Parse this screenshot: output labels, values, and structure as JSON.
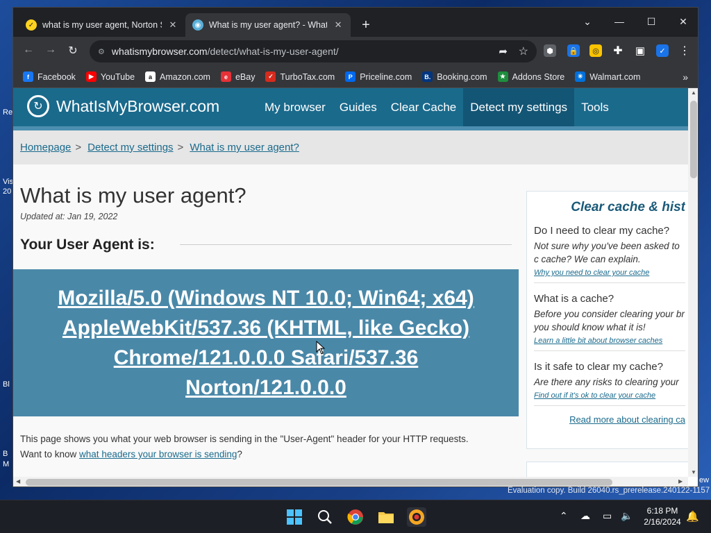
{
  "browser": {
    "tabs": [
      {
        "title": "what is my user agent, Norton S",
        "icon": "norton-icon"
      },
      {
        "title": "What is my user agent? - WhatIs",
        "icon": "whatismybrowser-icon"
      }
    ],
    "url_host": "whatismybrowser.com",
    "url_path": "/detect/what-is-my-user-agent/",
    "bookmarks": [
      {
        "label": "Facebook",
        "icon": "facebook-icon",
        "color": "#1877f2",
        "glyph": "f"
      },
      {
        "label": "YouTube",
        "icon": "youtube-icon",
        "color": "#ff0000",
        "glyph": "▶"
      },
      {
        "label": "Amazon.com",
        "icon": "amazon-icon",
        "color": "#ffffff",
        "glyph": "a"
      },
      {
        "label": "eBay",
        "icon": "ebay-icon",
        "color": "#e53238",
        "glyph": "e"
      },
      {
        "label": "TurboTax.com",
        "icon": "turbotax-icon",
        "color": "#d52b1e",
        "glyph": "✓"
      },
      {
        "label": "Priceline.com",
        "icon": "priceline-icon",
        "color": "#0068ef",
        "glyph": "P"
      },
      {
        "label": "Booking.com",
        "icon": "booking-icon",
        "color": "#003580",
        "glyph": "B."
      },
      {
        "label": "Addons Store",
        "icon": "addons-store-icon",
        "color": "#1e8e3e",
        "glyph": "★"
      },
      {
        "label": "Walmart.com",
        "icon": "walmart-icon",
        "color": "#0071dc",
        "glyph": "✳"
      }
    ]
  },
  "site": {
    "brand": "WhatIsMyBrowser.com",
    "nav": [
      {
        "label": "My browser",
        "active": false
      },
      {
        "label": "Guides",
        "active": false
      },
      {
        "label": "Clear Cache",
        "active": false
      },
      {
        "label": "Detect my settings",
        "active": true
      },
      {
        "label": "Tools",
        "active": false
      }
    ],
    "breadcrumbs": [
      "Homepage",
      "Detect my settings",
      "What is my user agent?"
    ],
    "breadcrumb_sep": ">",
    "title": "What is my user agent?",
    "updated": "Updated at: Jan 19, 2022",
    "ua_heading": "Your User Agent is:",
    "ua_lines": [
      "Mozilla/5.0 (Windows NT 10.0; Win64; x64)",
      "AppleWebKit/537.36 (KHTML, like Gecko)",
      "Chrome/121.0.0.0 Safari/537.36",
      "Norton/121.0.0.0"
    ],
    "para1": "This page shows you what your web browser is sending in the \"User-Agent\" header for your HTTP requests.",
    "para2_prefix": "Want to know ",
    "para2_link": "what headers your browser is sending",
    "para2_suffix": "?",
    "sidebar": {
      "title": "Clear cache & hist",
      "items": [
        {
          "q": "Do I need to clear my cache?",
          "a": "Not sure why you've been asked to c cache? We can explain.",
          "link": "Why you need to clear your cache"
        },
        {
          "q": "What is a cache?",
          "a": "Before you consider clearing your br you should know what it is!",
          "link": "Learn a little bit about browser caches"
        },
        {
          "q": "Is it safe to clear my cache?",
          "a": "Are there any risks to clearing your",
          "link": "Find out if it's ok to clear your cache"
        }
      ],
      "more": "Read more about clearing ca"
    }
  },
  "desktop": {
    "eval_text": "Evaluation copy. Build 26040.rs_prerelease.240122-1157",
    "time": "6:18 PM",
    "date": "2/16/2024",
    "side_labels": [
      "Re",
      "Vis",
      "20",
      "Bl",
      "B",
      "M"
    ],
    "right_edge_label": "ew"
  }
}
